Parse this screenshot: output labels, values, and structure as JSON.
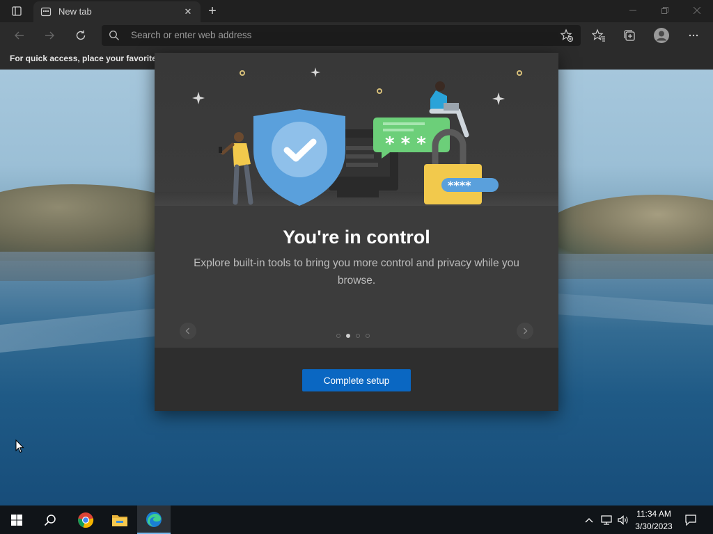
{
  "browser": {
    "tab_title": "New tab",
    "address_placeholder": "Search or enter web address",
    "favorites_bar_text": "For quick access, place your favorites h"
  },
  "dialog": {
    "title": "You're in control",
    "description": "Explore built-in tools to bring you more control and privacy while you browse.",
    "primary_button": "Complete setup",
    "pager": {
      "total": 4,
      "current": 2
    }
  },
  "taskbar": {
    "apps": [
      "start-icon",
      "search-icon",
      "chrome-icon",
      "file-explorer-icon",
      "edge-icon"
    ],
    "active_app": "edge-icon",
    "time": "11:34 AM",
    "date": "3/30/2023"
  },
  "colors": {
    "accent": "#0a67c2",
    "dialog_bg": "#3c3c3c",
    "chrome_bg": "#2b2b2b"
  }
}
